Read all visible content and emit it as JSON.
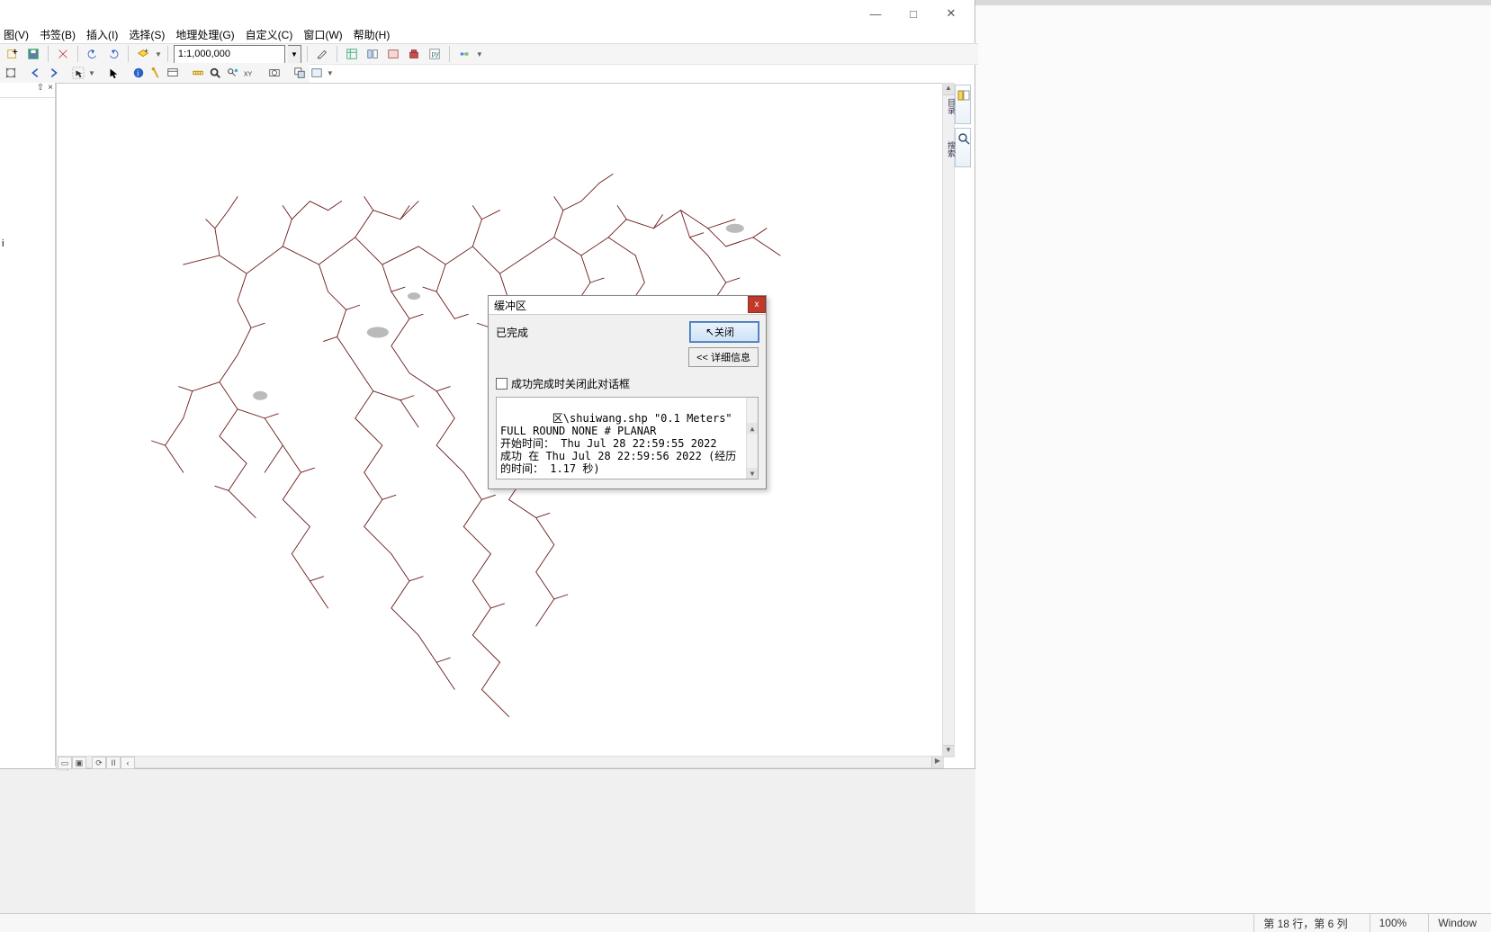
{
  "window_controls": {
    "minimize_glyph": "—",
    "maximize_glyph": "□",
    "close_glyph": "✕"
  },
  "menu": {
    "view": "图(V)",
    "bookmark": "书签(B)",
    "insert": "插入(I)",
    "select": "选择(S)",
    "geoprocessing": "地理处理(G)",
    "customize": "自定义(C)",
    "window": "窗口(W)",
    "help": "帮助(H)"
  },
  "toolbar": {
    "scale_value": "1:1,000,000"
  },
  "toc": {
    "pin_glyph": "⇧",
    "close_glyph": "×",
    "item_placeholder": "i"
  },
  "right_dock": {
    "tab1": "目录",
    "tab2": "搜索"
  },
  "dialog": {
    "title": "缓冲区",
    "status": "已完成",
    "close_button": "关闭",
    "cursor": "↖",
    "dlg_close_x": "x",
    "details_button": "<< 详细信息",
    "checkbox_label": "成功完成时关闭此对话框",
    "log_text": "区\\shuiwang.shp \"0.1 Meters\" FULL ROUND NONE # PLANAR\n开始时间： Thu Jul 28 22:59:55 2022\n成功 在 Thu Jul 28 22:59:56 2022 (经历的时间： 1.17 秒)"
  },
  "scrollbars": {
    "up": "▲",
    "down": "▼",
    "left": "◀",
    "right": "▶"
  },
  "view_tabs": {
    "data_glyph": "▭",
    "layout_glyph": "▣",
    "refresh_glyph": "⟳",
    "pause_glyph": "ⅠⅠ",
    "left_glyph": "‹"
  },
  "outer_status": {
    "position": "第 18 行，第 6 列",
    "zoom": "100%",
    "os": "Window"
  }
}
